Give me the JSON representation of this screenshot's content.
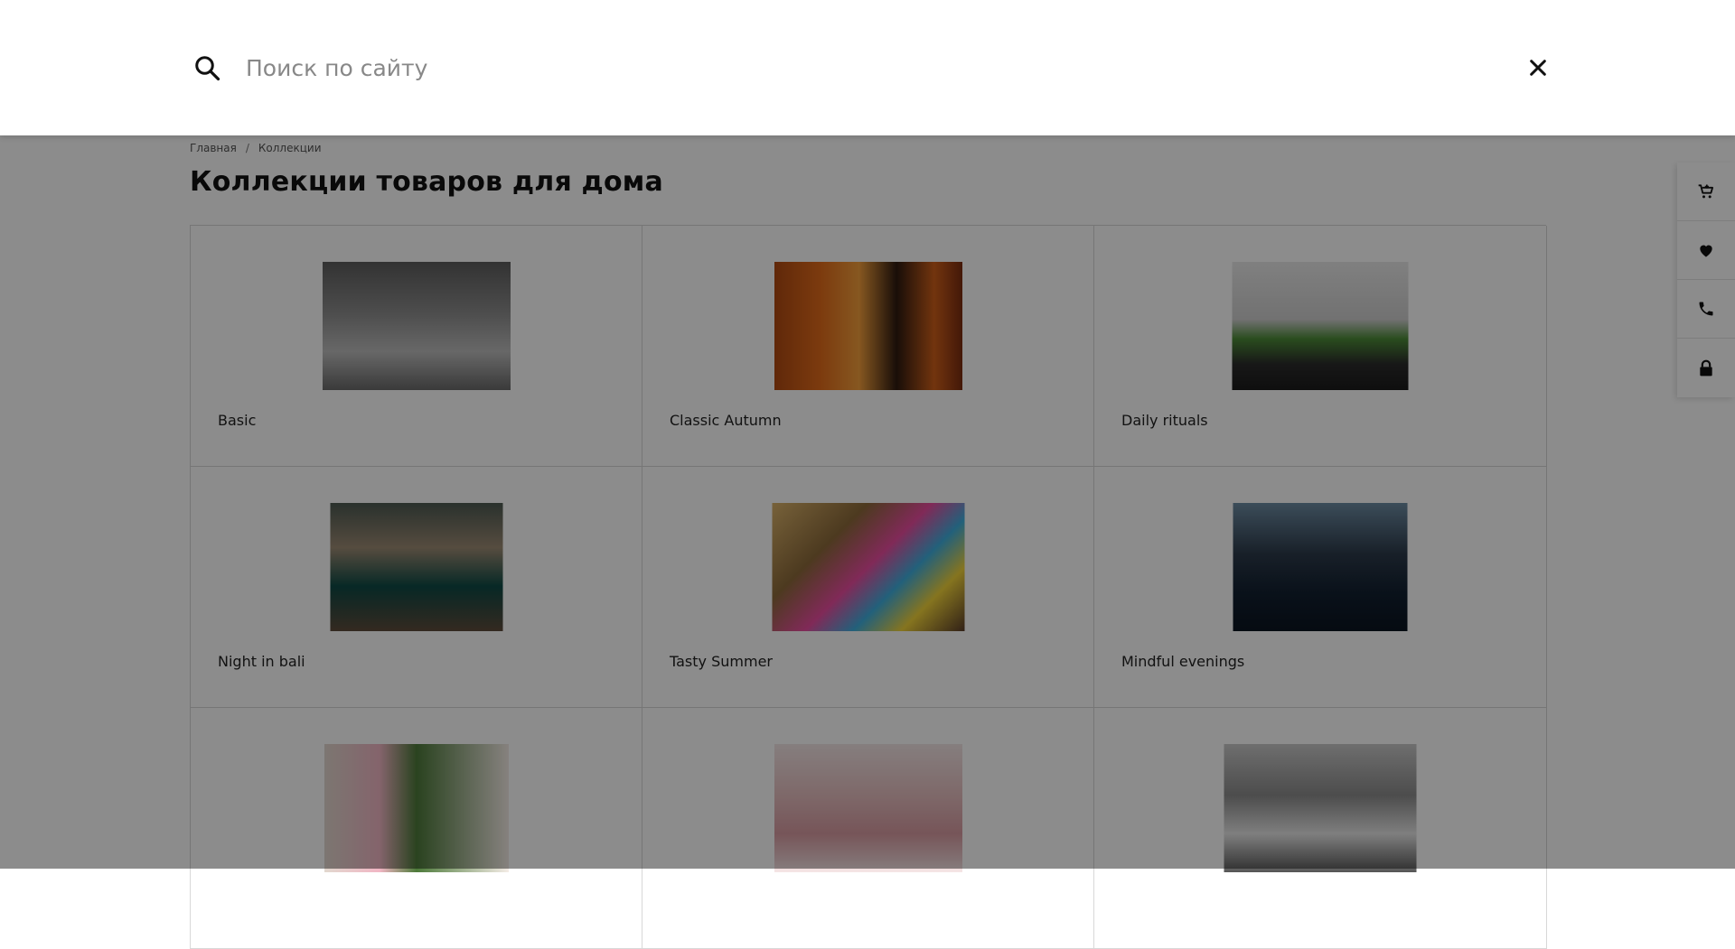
{
  "search": {
    "placeholder": "Поиск по сайту"
  },
  "breadcrumb": {
    "items": [
      "Главная",
      "Коллекции"
    ],
    "separator": "/"
  },
  "page": {
    "title": "Коллекции товаров для дома"
  },
  "collections": [
    {
      "name": "Basic"
    },
    {
      "name": "Classic Autumn"
    },
    {
      "name": "Daily rituals"
    },
    {
      "name": "Night in bali"
    },
    {
      "name": "Tasty Summer"
    },
    {
      "name": "Mindful evenings"
    },
    {
      "name": ""
    },
    {
      "name": ""
    },
    {
      "name": ""
    }
  ],
  "side_panel": {
    "icons": [
      "cart-icon",
      "heart-icon",
      "phone-icon",
      "lock-icon"
    ]
  },
  "colors": {
    "overlay": "rgba(0,0,0,0.45)",
    "background": "#ffffff",
    "text": "#111111"
  }
}
